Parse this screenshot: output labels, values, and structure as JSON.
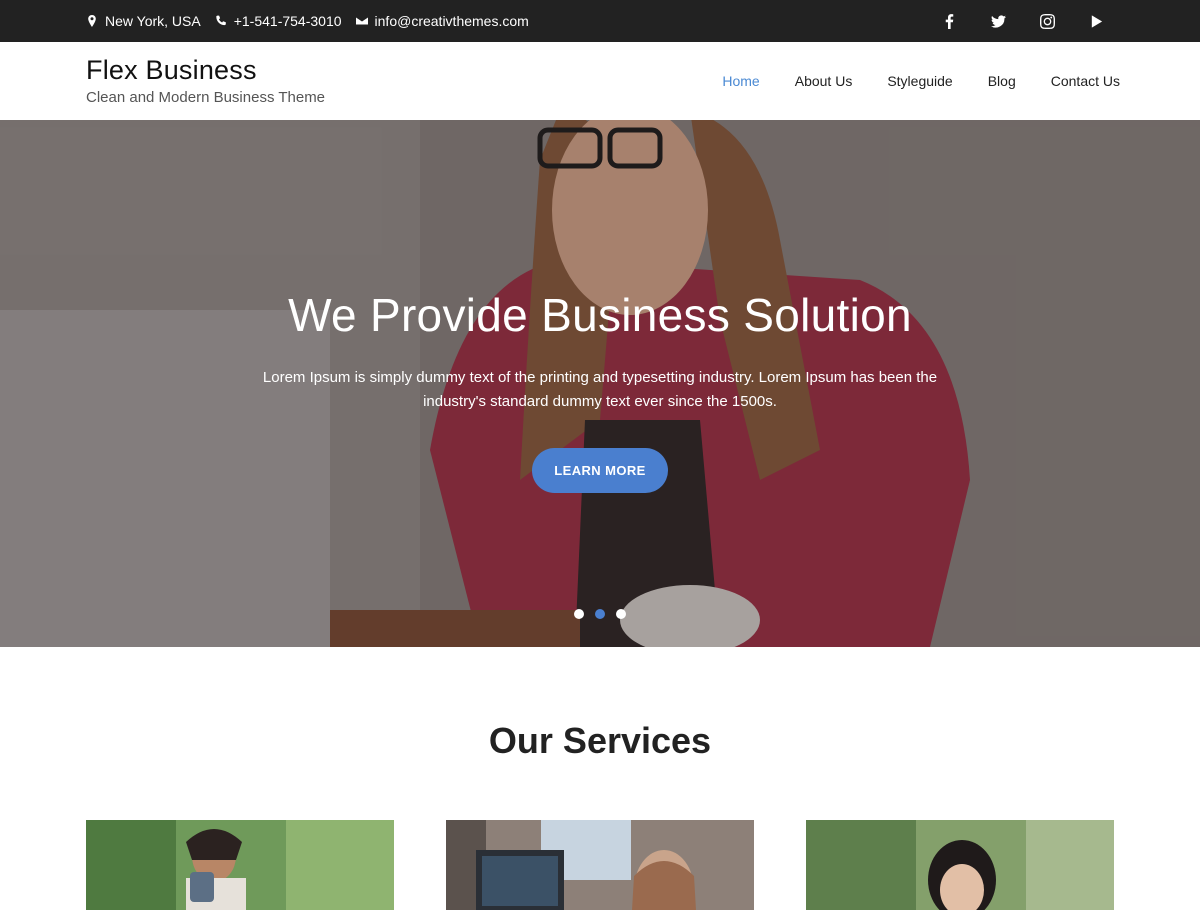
{
  "topbar": {
    "location": "New York, USA",
    "phone": "+1-541-754-3010",
    "email": "info@creativthemes.com",
    "social_icons": [
      "facebook-icon",
      "twitter-icon",
      "instagram-icon",
      "youtube-icon"
    ]
  },
  "header": {
    "site_title": "Flex Business",
    "tagline": "Clean and Modern Business Theme",
    "nav": [
      {
        "label": "Home",
        "active": true
      },
      {
        "label": "About Us",
        "active": false
      },
      {
        "label": "Styleguide",
        "active": false
      },
      {
        "label": "Blog",
        "active": false
      },
      {
        "label": "Contact Us",
        "active": false
      }
    ]
  },
  "hero": {
    "title": "We Provide Business Solution",
    "text": "Lorem Ipsum is simply dummy text of the printing and typesetting industry. Lorem Ipsum has been the industry's standard dummy text ever since the 1500s.",
    "button_label": "LEARN MORE",
    "slides": 3,
    "active_slide": 2
  },
  "services": {
    "heading": "Our Services"
  },
  "colors": {
    "accent": "#4a7fcf",
    "topbar_bg": "#222222",
    "nav_active": "#4a89d3"
  }
}
